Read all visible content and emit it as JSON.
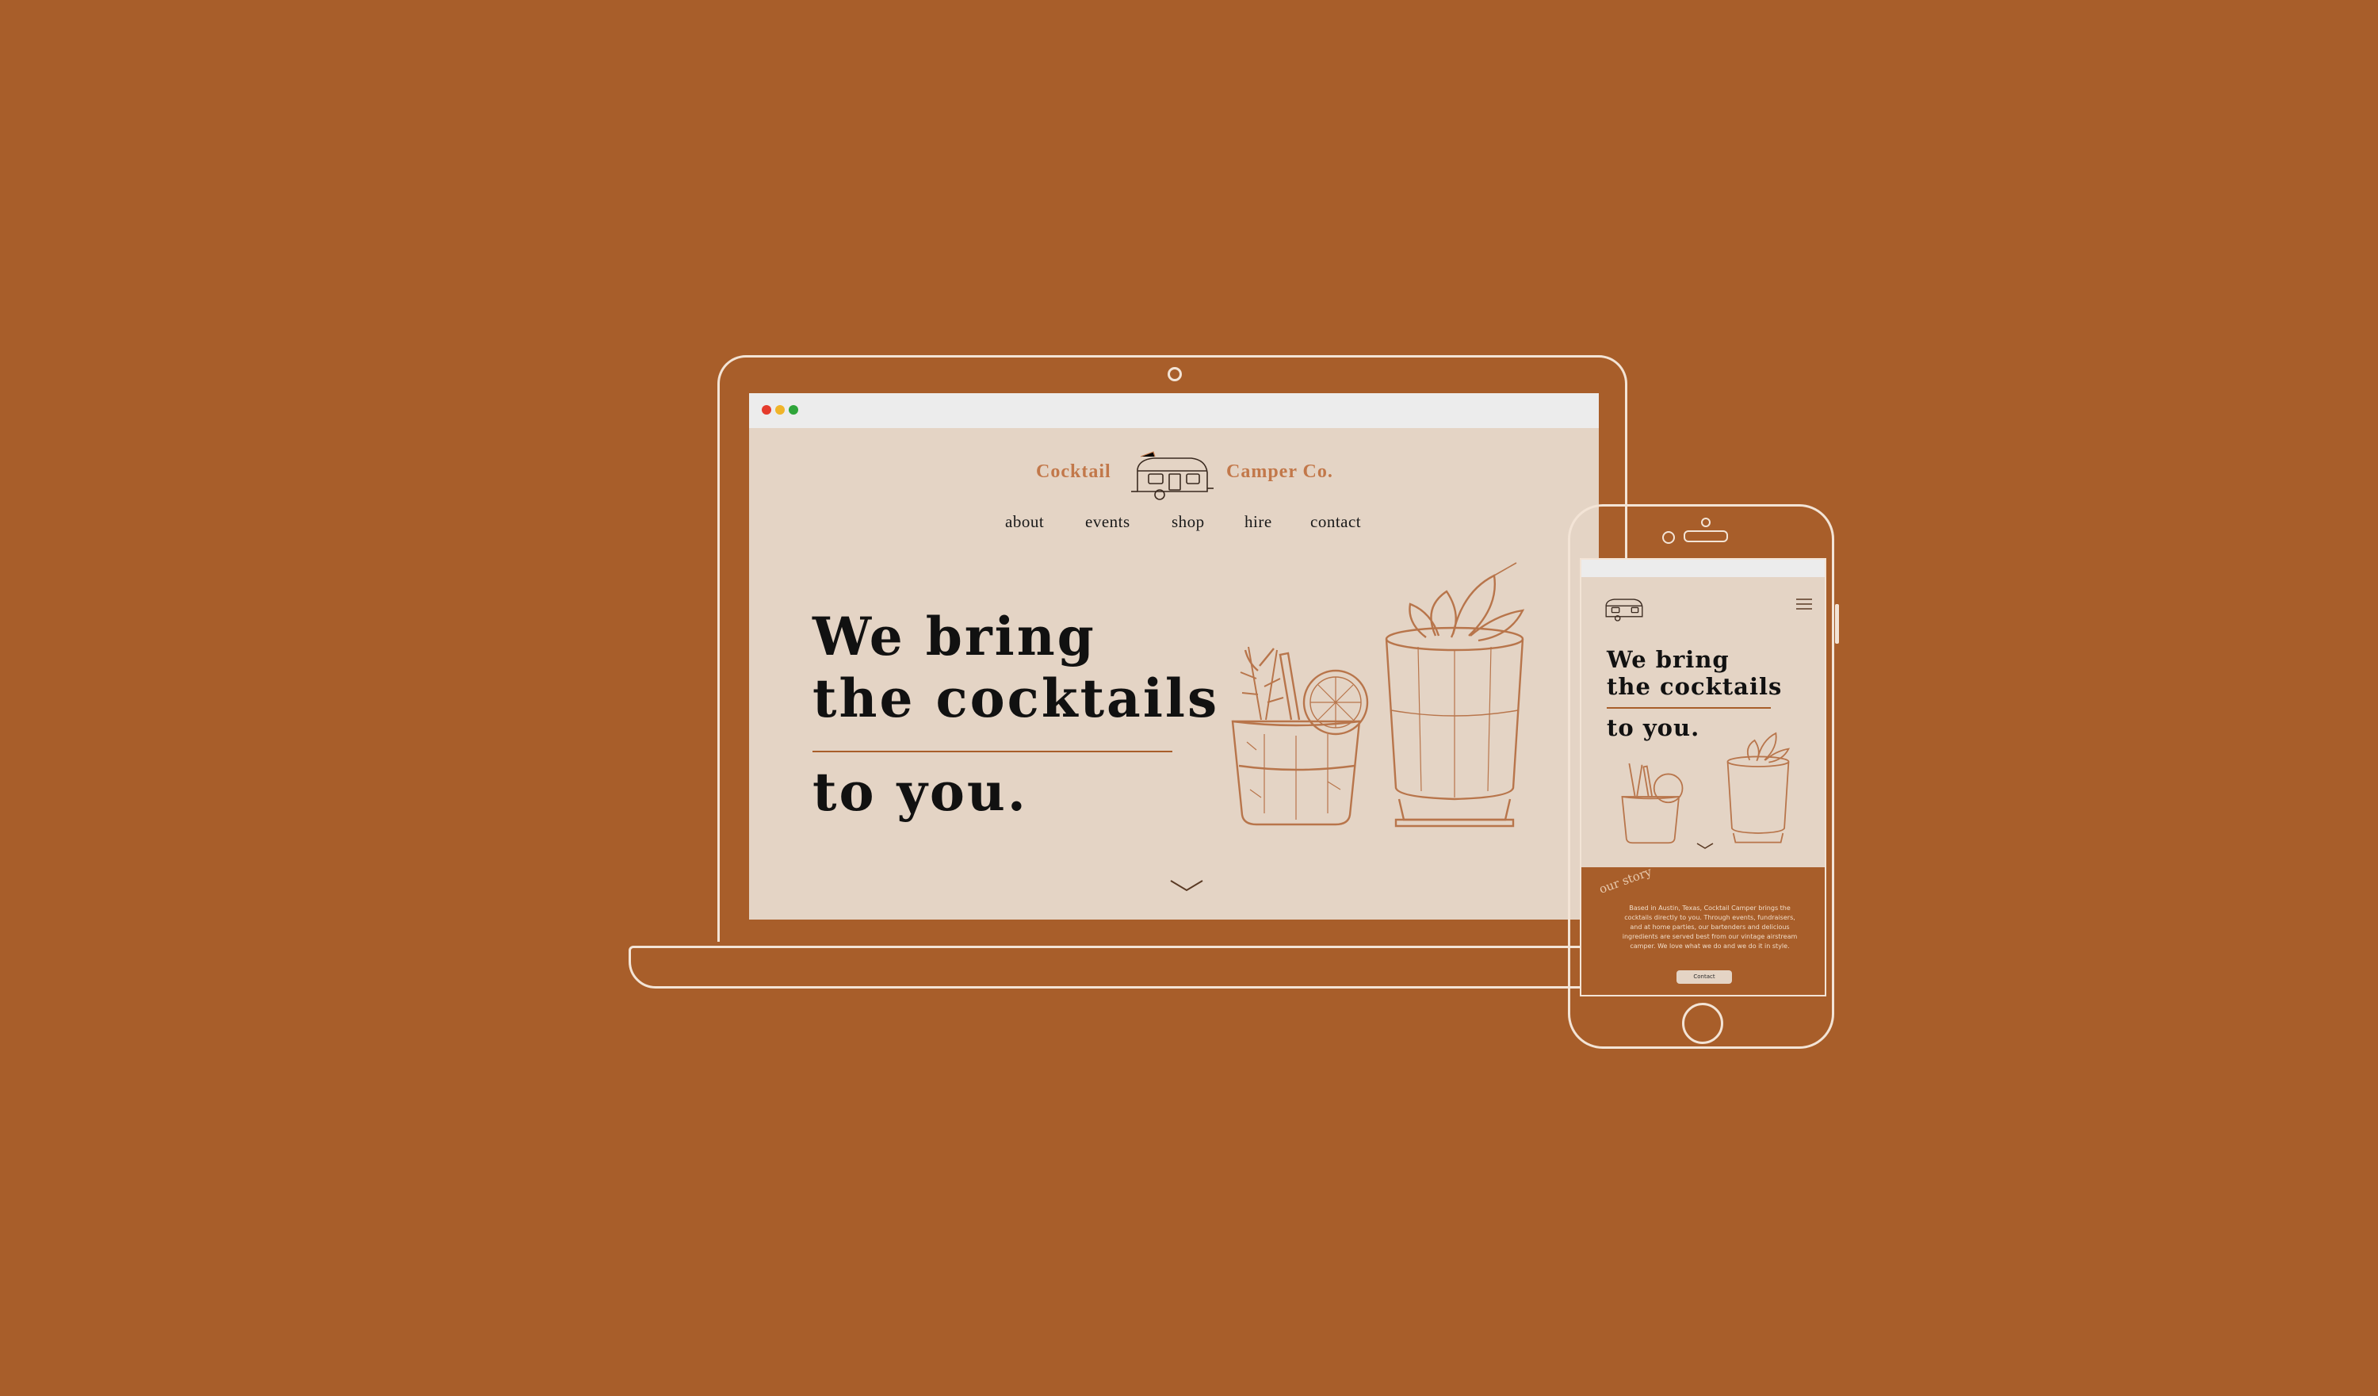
{
  "colors": {
    "background": "#a85e2a",
    "screen": "#e4d4c5",
    "accent": "#c2784a",
    "text": "#111111",
    "outline": "#f3e4d6"
  },
  "desktop": {
    "logo": {
      "left_word": "Cocktail",
      "right_word": "Camper Co.",
      "icon": "camper-trailer-icon"
    },
    "nav": [
      "about",
      "events",
      "shop",
      "hire",
      "contact"
    ],
    "hero": {
      "line1": "We bring",
      "line2": "the cocktails",
      "line3": "to you."
    },
    "illustrations": [
      "cocktail-glass-illustration",
      "mint-julep-cup-illustration"
    ],
    "scroll_icon": "chevron-down-icon"
  },
  "mobile": {
    "logo_icon": "camper-trailer-icon",
    "menu_icon": "hamburger-menu-icon",
    "hero": {
      "line1": "We bring",
      "line2": "the cocktails",
      "line3": "to you."
    },
    "story": {
      "title": "our story",
      "body": "Based in Austin, Texas, Cocktail Camper brings the cocktails directly to you. Through events, fundraisers, and at home parties, our bartenders and delicious ingredients are served best from our vintage airstream camper. We love what we do and we do it in style.",
      "button": "Contact"
    }
  }
}
